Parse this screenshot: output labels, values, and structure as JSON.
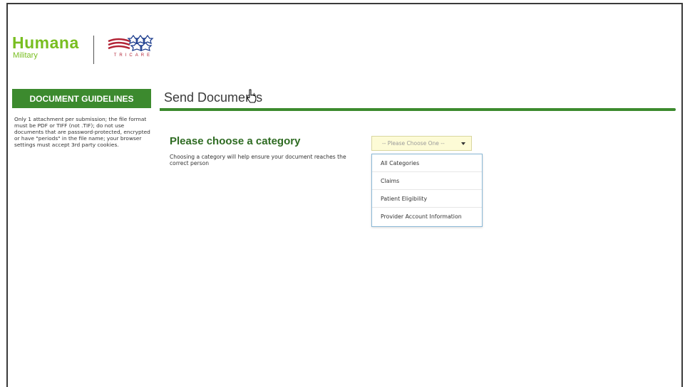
{
  "logo": {
    "humana_name": "Humana",
    "humana_sub": "Military",
    "tricare_text": "TRICARE"
  },
  "sidebar": {
    "header": "DOCUMENT GUIDELINES",
    "guidelines": "Only 1 attachment per submission; the file format must be PDF or TIFF (not .TIF); do not use documents that are password-protected, encrypted or have \"periods\" in the file name; your browser settings must accept 3rd party cookies."
  },
  "main": {
    "title": "Send Documents",
    "category_heading": "Please choose a category",
    "category_help": "Choosing a category will help ensure your document reaches the correct person"
  },
  "category_select": {
    "selected": "-- Please Choose One --",
    "options": [
      "All Categories",
      "Claims",
      "Patient Eligibility",
      "Provider Account Information"
    ]
  },
  "colors": {
    "brand_green": "#78be20",
    "header_green": "#3c8a2e",
    "tricare_red": "#b22234",
    "tricare_blue": "#1f3f8f"
  }
}
